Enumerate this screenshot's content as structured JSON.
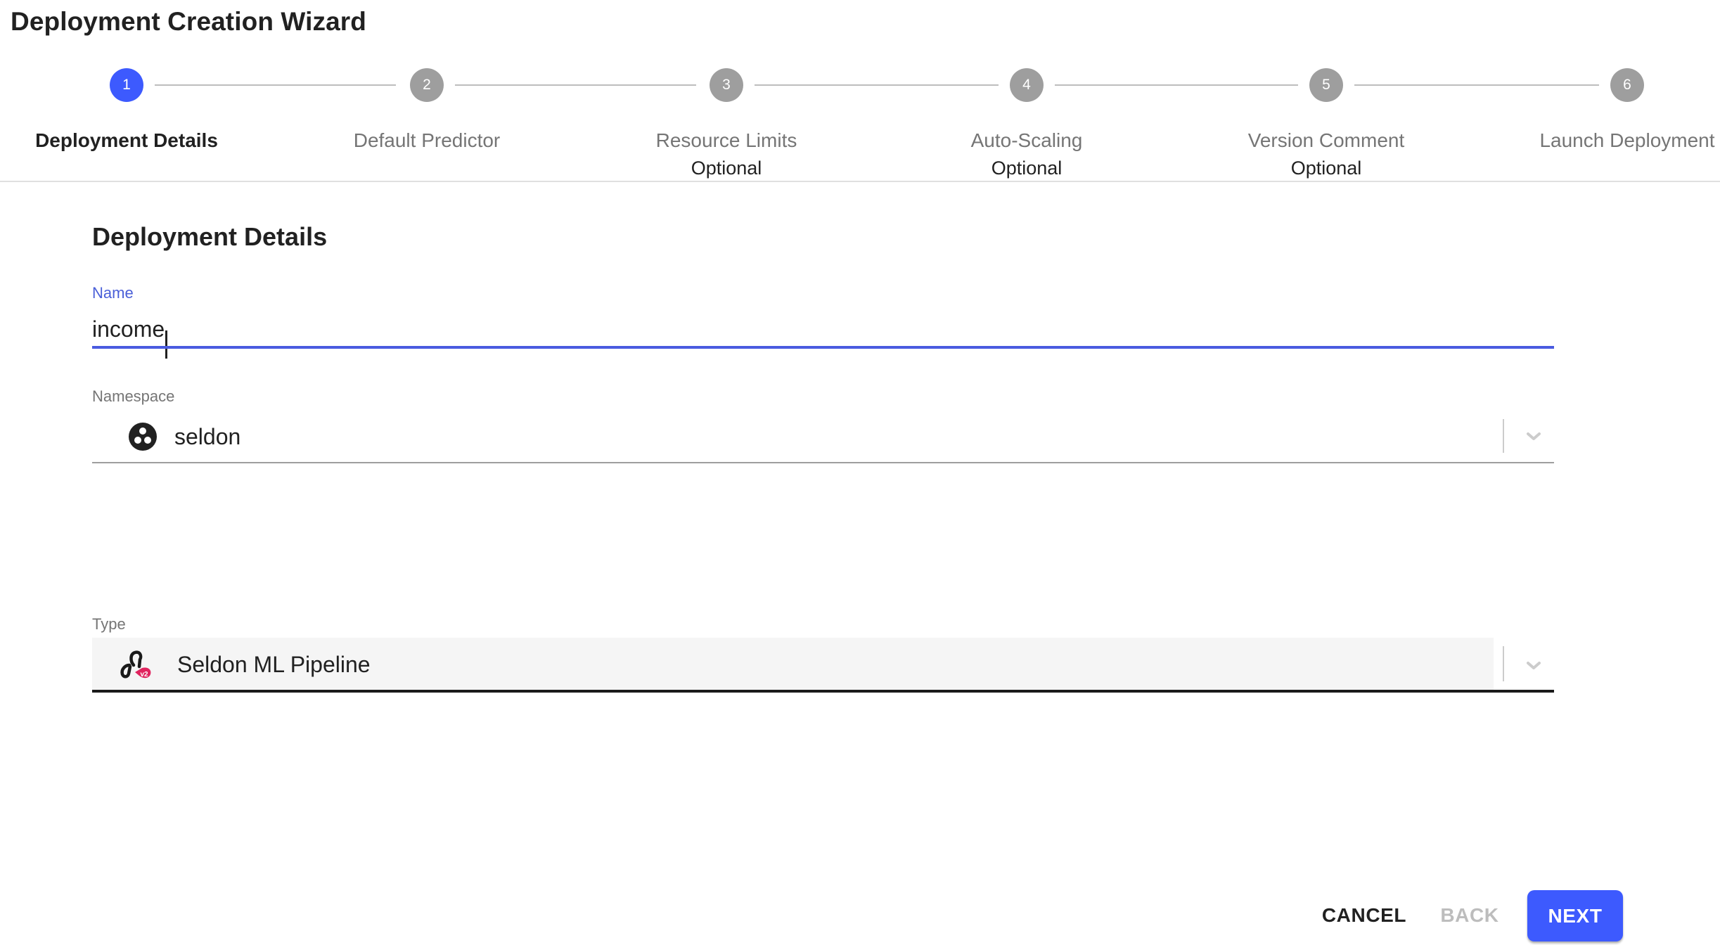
{
  "wizard": {
    "title": "Deployment Creation Wizard"
  },
  "stepper": {
    "active_step": 1,
    "steps": [
      {
        "number": "1",
        "label": "Deployment Details",
        "optional": "",
        "state": "active"
      },
      {
        "number": "2",
        "label": "Default Predictor",
        "optional": "",
        "state": "inactive"
      },
      {
        "number": "3",
        "label": "Resource Limits",
        "optional": "Optional",
        "state": "inactive"
      },
      {
        "number": "4",
        "label": "Auto-Scaling",
        "optional": "Optional",
        "state": "inactive"
      },
      {
        "number": "5",
        "label": "Version Comment",
        "optional": "Optional",
        "state": "inactive"
      },
      {
        "number": "6",
        "label": "Launch Deployment",
        "optional": "",
        "state": "inactive"
      }
    ]
  },
  "form": {
    "heading": "Deployment Details",
    "name": {
      "label": "Name",
      "value": "income",
      "focused": true
    },
    "namespace": {
      "label": "Namespace",
      "value": "seldon",
      "icon": "namespace-icon"
    },
    "type": {
      "label": "Type",
      "value": "Seldon ML Pipeline",
      "icon": "seldon-pipeline-v2-icon",
      "icon_badge": "v2"
    }
  },
  "footer": {
    "cancel_label": "Cancel",
    "back_label": "Back",
    "next_label": "Next",
    "back_disabled": true
  },
  "colors": {
    "primary": "#3d5afe",
    "focus_underline": "#4a5be0",
    "step_inactive": "#9e9e9e",
    "badge_pink": "#e0245e"
  }
}
